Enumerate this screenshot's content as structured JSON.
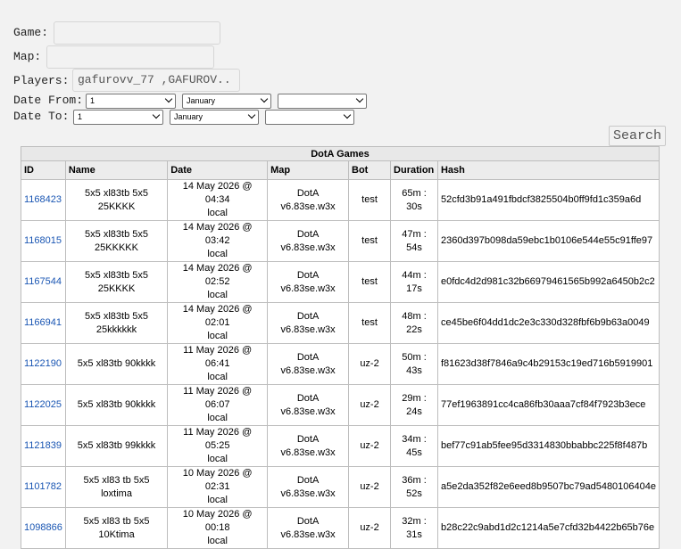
{
  "form": {
    "game_label": "Game:",
    "game_value": "",
    "map_label": "Map:",
    "map_value": "",
    "players_label": "Players:",
    "players_value": "gafurovv_77 ,GAFUROV..",
    "date_from_label": "Date From:",
    "date_to_label": "Date To:",
    "date_from": {
      "day": "1",
      "month": "January",
      "year": ""
    },
    "date_to": {
      "day": "1",
      "month": "January",
      "year": ""
    },
    "search_label": "Search"
  },
  "table": {
    "caption": "DotA Games",
    "headers": [
      "ID",
      "Name",
      "Date",
      "Map",
      "Bot",
      "Duration",
      "Hash"
    ],
    "rows": [
      {
        "id": "1168423",
        "name": "5x5 xl83tb 5x5 25KKKK",
        "date": "14 May 2026 @ 04:34",
        "tz": "local",
        "map": "DotA v6.83se.w3x",
        "bot": "test",
        "duration": "65m : 30s",
        "hash": "52cfd3b91a491fbdcf3825504b0ff9fd1c359a6d"
      },
      {
        "id": "1168015",
        "name": "5x5 xl83tb 5x5 25KKKKK",
        "date": "14 May 2026 @ 03:42",
        "tz": "local",
        "map": "DotA v6.83se.w3x",
        "bot": "test",
        "duration": "47m : 54s",
        "hash": "2360d397b098da59ebc1b0106e544e55c91ffe97"
      },
      {
        "id": "1167544",
        "name": "5x5 xl83tb 5x5 25KKKK",
        "date": "14 May 2026 @ 02:52",
        "tz": "local",
        "map": "DotA v6.83se.w3x",
        "bot": "test",
        "duration": "44m : 17s",
        "hash": "e0fdc4d2d981c32b66979461565b992a6450b2c2"
      },
      {
        "id": "1166941",
        "name": "5x5 xl83tb 5x5 25kkkkkk",
        "date": "14 May 2026 @ 02:01",
        "tz": "local",
        "map": "DotA v6.83se.w3x",
        "bot": "test",
        "duration": "48m : 22s",
        "hash": "ce45be6f04dd1dc2e3c330d328fbf6b9b63a0049"
      },
      {
        "id": "1122190",
        "name": "5x5 xl83tb 90kkkk",
        "date": "11 May 2026 @ 06:41",
        "tz": "local",
        "map": "DotA v6.83se.w3x",
        "bot": "uz-2",
        "duration": "50m : 43s",
        "hash": "f81623d38f7846a9c4b29153c19ed716b5919901"
      },
      {
        "id": "1122025",
        "name": "5x5 xl83tb 90kkkk",
        "date": "11 May 2026 @ 06:07",
        "tz": "local",
        "map": "DotA v6.83se.w3x",
        "bot": "uz-2",
        "duration": "29m : 24s",
        "hash": "77ef1963891cc4ca86fb30aaa7cf84f7923b3ece"
      },
      {
        "id": "1121839",
        "name": "5x5 xl83tb 99kkkk",
        "date": "11 May 2026 @ 05:25",
        "tz": "local",
        "map": "DotA v6.83se.w3x",
        "bot": "uz-2",
        "duration": "34m : 45s",
        "hash": "bef77c91ab5fee95d3314830bbabbc225f8f487b"
      },
      {
        "id": "1101782",
        "name": "5x5 xl83 tb 5x5 loxtima",
        "date": "10 May 2026 @ 02:31",
        "tz": "local",
        "map": "DotA v6.83se.w3x",
        "bot": "uz-2",
        "duration": "36m : 52s",
        "hash": "a5e2da352f82e6eed8b9507bc79ad5480106404e"
      },
      {
        "id": "1098866",
        "name": "5x5 xl83 tb 5x5 10Ktima",
        "date": "10 May 2026 @ 00:18",
        "tz": "local",
        "map": "DotA v6.83se.w3x",
        "bot": "uz-2",
        "duration": "32m : 31s",
        "hash": "b28c22c9abd1d2c1214a5e7cfd32b4422b65b76e"
      }
    ]
  },
  "colors": {
    "link": "#1a56b3",
    "background": "#f2f2f2"
  },
  "icons": {
    "select_arrow": "chevron-down-icon"
  }
}
